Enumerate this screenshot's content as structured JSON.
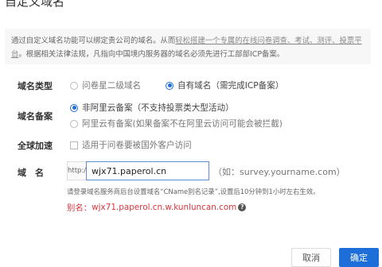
{
  "dialog": {
    "title": "自定义域名"
  },
  "notice": {
    "text_before_link1": "通过自定义域名功能可以绑定贵公司的域名。从而",
    "link1": "轻松搭建一个专属的在线问卷调查、考试、测评、投票平台",
    "text_after_link1": "。根据相关法律法规，凡指向中国境内服务器的域名必须先进行工部部ICP备案。"
  },
  "domain_type": {
    "label": "域名类型",
    "options": [
      "问卷星二级域名",
      "自有域名（需完成ICP备案）"
    ],
    "selected_index": 1
  },
  "domain_filing": {
    "label": "域名备案",
    "options": [
      "非阿里云备案（不支持投票类大型活动）",
      "阿里云有备案(如果备案不在阿里云访问可能会被拦截)"
    ],
    "selected_index": 0
  },
  "global_acceleration": {
    "label": "全球加速",
    "checkbox_label": "适用于问卷要被国外客户访问",
    "checked": false
  },
  "domain": {
    "label": "域　名",
    "prefix": "http://",
    "value": "wjx71.paperol.cn",
    "example": "（如：survey.yourname.com）",
    "hint": "请登录域名服务商后台设置域名“CName别名记录”,设置后10分钟到1小时左右生效。",
    "alias_label": "别名：",
    "alias_value": "wjx71.paperol.cn.w.kunluncan.com",
    "alias_help_icon": "question-circle-icon"
  },
  "footer": {
    "cancel_label": "取消",
    "ok_label": "确定"
  },
  "colors": {
    "accent": "#1d6ed8",
    "alias_red": "#d9363e"
  }
}
